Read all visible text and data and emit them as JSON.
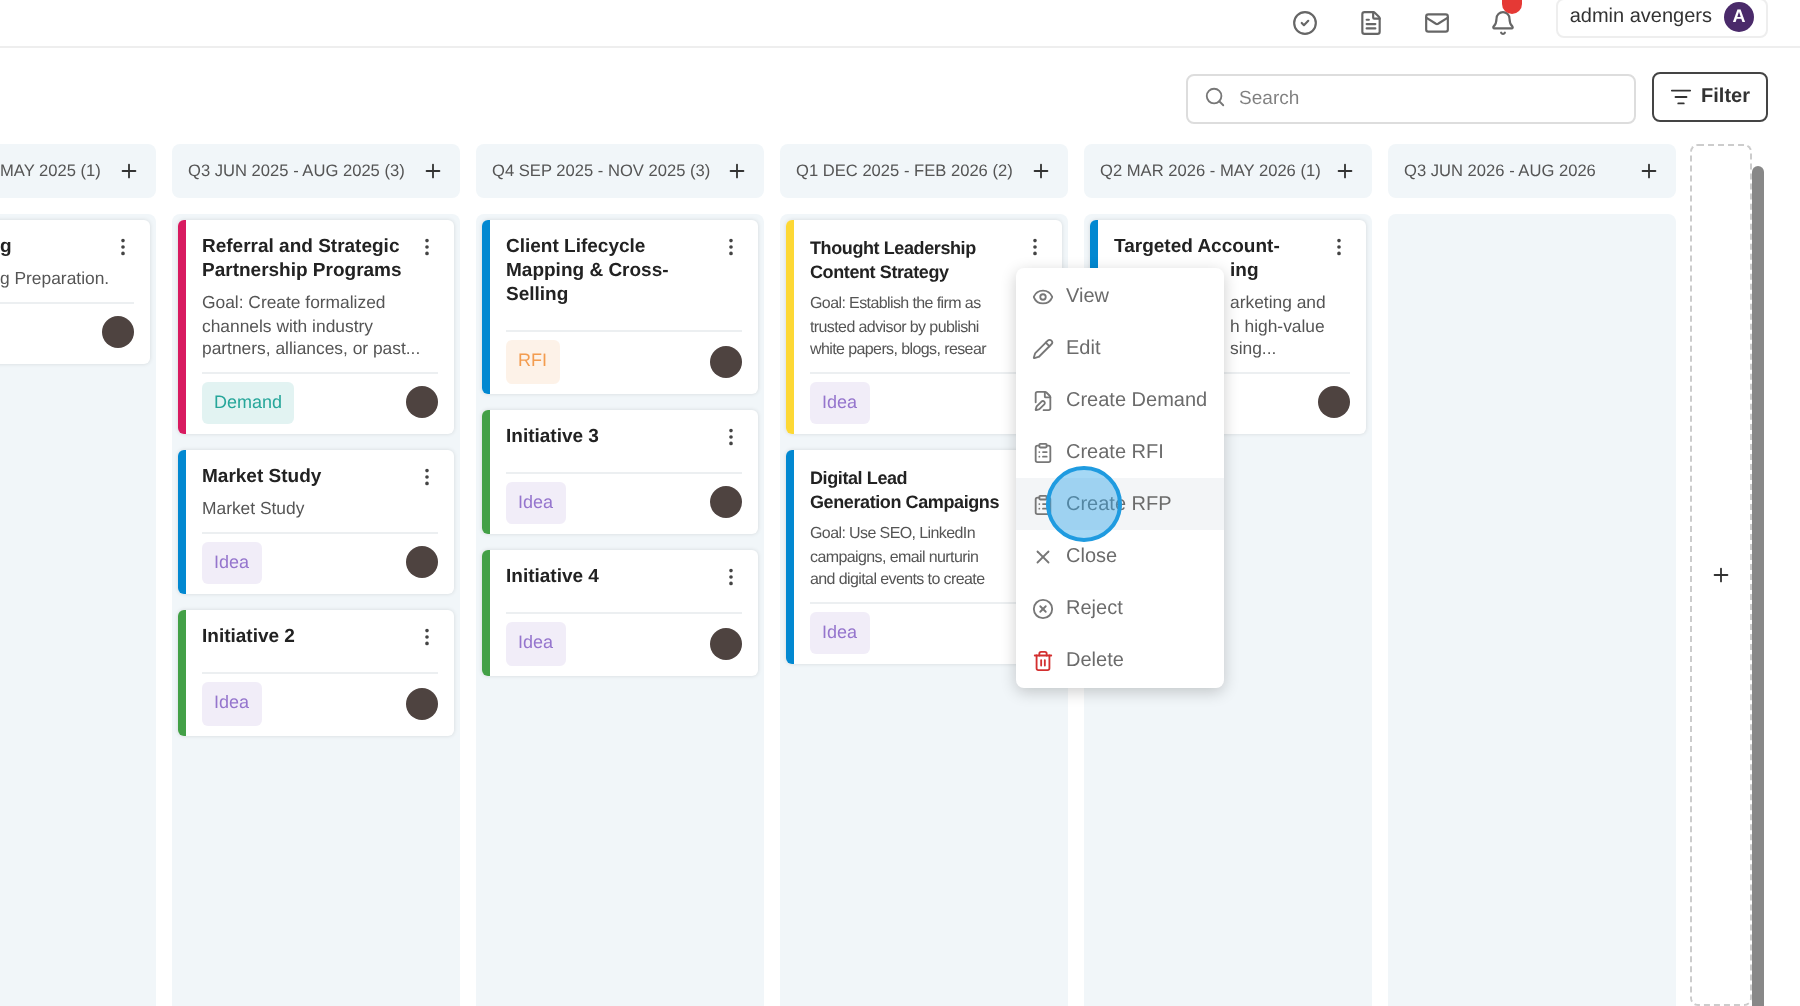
{
  "topbar": {
    "user": {
      "name": "admin avengers",
      "initial": "A"
    },
    "notification_badge": true
  },
  "toolbar": {
    "search": {
      "placeholder": "Search"
    },
    "filter_button": "Filter"
  },
  "columns": [
    {
      "header": "MAY 2025 (1)",
      "clipped": true,
      "cards": [
        {
          "kind": "plain",
          "title": "g",
          "desc": "g Preparation.",
          "avatar": true
        }
      ]
    },
    {
      "header": "Q3 JUN 2025 - AUG 2025 (3)",
      "cards": [
        {
          "kind": "plain",
          "color": "#d81b60",
          "title": "Referral and Strategic\nPartnership Programs",
          "desc": "Goal: Create formalized\nchannels with industry\npartners, alliances, or past...",
          "tag": {
            "label": "Demand",
            "color": "#26a69a"
          },
          "avatar": true
        },
        {
          "kind": "plain",
          "color": "#0288d1",
          "title": "Market Study",
          "desc": "Market Study",
          "tag": {
            "label": "Idea",
            "color": "#9575cd"
          },
          "avatar": true
        },
        {
          "kind": "plain",
          "color": "#43a047",
          "title": "Initiative 2",
          "tag": {
            "label": "Idea",
            "color": "#9575cd"
          },
          "avatar": true
        }
      ]
    },
    {
      "header": "Q4 SEP 2025 - NOV 2025 (3)",
      "cards": [
        {
          "kind": "plain",
          "color": "#0288d1",
          "title": "Client Lifecycle\nMapping & Cross-\nSelling",
          "tag": {
            "label": "RFI",
            "color": "#f39c4f"
          },
          "avatar": true
        },
        {
          "kind": "plain",
          "color": "#43a047",
          "title": "Initiative 3",
          "tag": {
            "label": "Idea",
            "color": "#9575cd"
          },
          "avatar": true
        },
        {
          "kind": "plain",
          "color": "#43a047",
          "title": "Initiative 4",
          "tag": {
            "label": "Idea",
            "color": "#9575cd"
          },
          "avatar": true
        }
      ]
    },
    {
      "header": "Q1 DEC 2025 - FEB 2026 (2)",
      "cards": [
        {
          "kind": "covered_right",
          "color": "#fdd835",
          "title": "Thought Leadership\nContent Strategy",
          "desc": "Goal: Establish the firm as\ntrusted advisor by publishi\nwhite papers, blogs, resear",
          "tag": {
            "label": "Idea",
            "color": "#9575cd"
          },
          "menu_open": true
        },
        {
          "kind": "covered_right",
          "color": "#0288d1",
          "title": "Digital Lead\nGeneration Campaigns",
          "desc": "Goal: Use SEO, LinkedIn\ncampaigns, email nurturin\nand digital events to create",
          "tag": {
            "label": "Idea",
            "color": "#9575cd"
          }
        }
      ]
    },
    {
      "header": "Q2 MAR 2026 - MAY 2026 (1)",
      "cards": [
        {
          "kind": "covered_left",
          "color": "#0288d1",
          "title": "Targeted Account-\ning",
          "desc": "arketing and\nh high-value\nsing...",
          "avatar": true
        }
      ]
    },
    {
      "header": "Q3 JUN 2026 - AUG 2026"
    }
  ],
  "menu": {
    "items": [
      {
        "label": "View",
        "selected": false
      },
      {
        "label": "Edit",
        "selected": false
      },
      {
        "label": "Create Demand",
        "selected": false
      },
      {
        "label": "Create RFI",
        "selected": false
      },
      {
        "label": "Create RFP",
        "selected": true
      },
      {
        "label": "Close",
        "selected": false
      },
      {
        "label": "Reject",
        "selected": false
      },
      {
        "label": "Delete",
        "selected": false
      }
    ]
  }
}
